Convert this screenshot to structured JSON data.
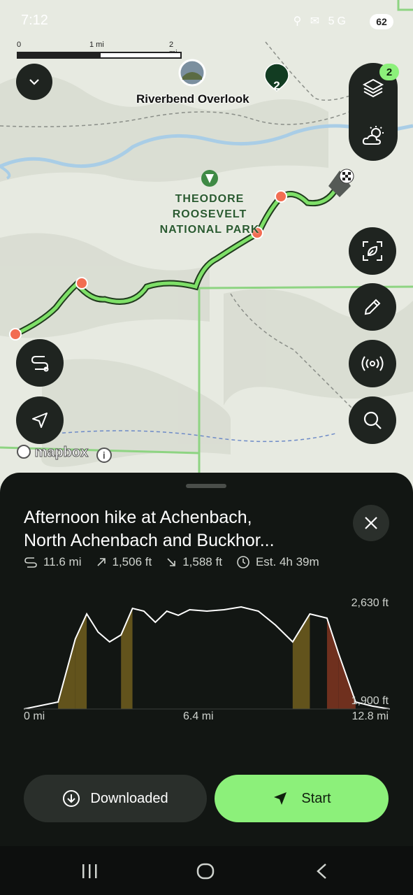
{
  "status_bar": {
    "time": "7:12",
    "signal_text": "5G",
    "battery": "62"
  },
  "map": {
    "scale": {
      "labels": [
        "0",
        "1 mi",
        "2 mi"
      ]
    },
    "poi": {
      "name": "Riverbend Overlook"
    },
    "cluster_count": "2",
    "park_label": [
      "THEODORE",
      "ROOSEVELT",
      "NATIONAL PARK"
    ],
    "attribution": "mapbox",
    "layers_badge": "2",
    "route_color": "#7ee068"
  },
  "sheet": {
    "title_lines": [
      "Afternoon hike at Achenbach,",
      "North Achenbach and Buckhor..."
    ],
    "stats": {
      "distance": "11.6 mi",
      "ascent": "1,506 ft",
      "descent": "1,588 ft",
      "estimate": "Est. 4h 39m"
    },
    "chart": {
      "y_max_label": "2,630 ft",
      "y_min_label": "1,900 ft",
      "x_labels": [
        "0 mi",
        "6.4 mi",
        "12.8 mi"
      ]
    },
    "buttons": {
      "downloaded": "Downloaded",
      "start": "Start"
    }
  },
  "chart_data": {
    "type": "area",
    "x": [
      0,
      1.2,
      1.8,
      2.2,
      2.6,
      3.0,
      3.4,
      3.8,
      4.2,
      4.6,
      5.0,
      5.4,
      5.8,
      6.4,
      7.0,
      7.6,
      8.2,
      8.8,
      9.4,
      10.0,
      10.6,
      11.0,
      11.6,
      12.2,
      12.8
    ],
    "values": [
      1900,
      1950,
      2400,
      2580,
      2450,
      2380,
      2430,
      2620,
      2600,
      2520,
      2600,
      2570,
      2610,
      2600,
      2610,
      2630,
      2600,
      2500,
      2380,
      2580,
      2550,
      2300,
      1950,
      1920,
      1900
    ],
    "ylim": [
      1900,
      2630
    ],
    "xlim": [
      0,
      12.8
    ],
    "grid": false
  }
}
